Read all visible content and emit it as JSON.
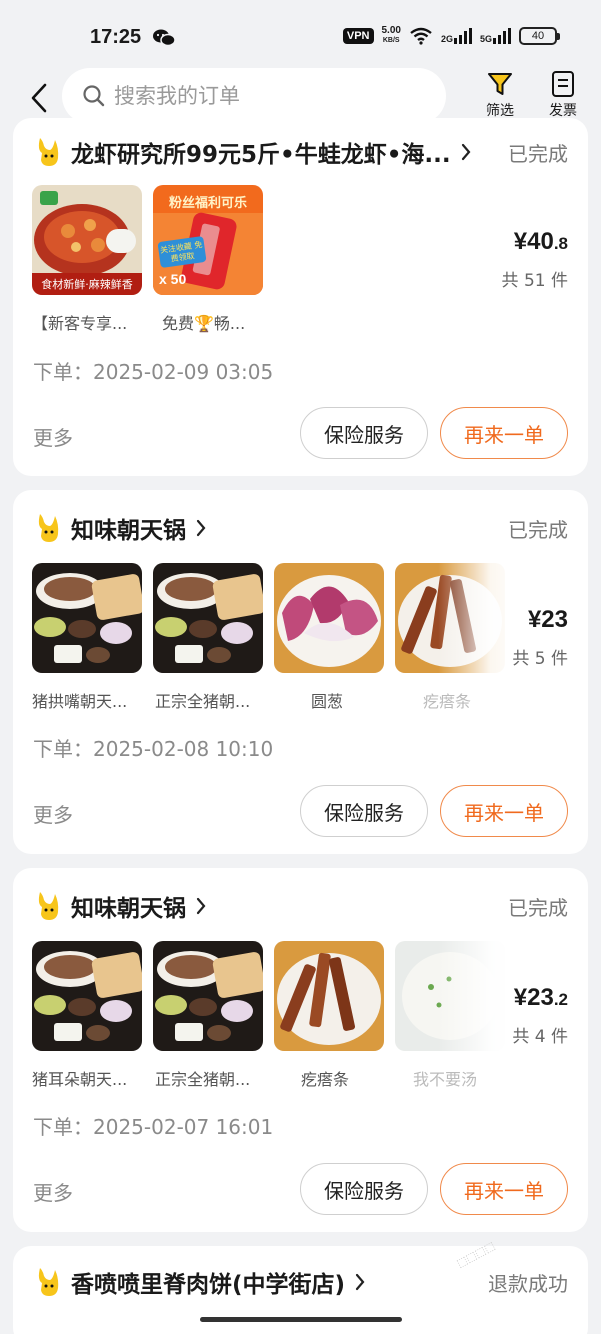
{
  "status_bar": {
    "time": "17:25",
    "vpn": "VPN",
    "speed": "5.00",
    "speed_unit": "KB/S",
    "net1": "2G",
    "net2": "5G",
    "battery": "40"
  },
  "header": {
    "search_placeholder": "搜索我的订单",
    "filter_label": "筛选",
    "invoice_label": "发票"
  },
  "orders": [
    {
      "shop": "龙虾研究所99元5斤•牛蛙龙虾•海...",
      "status": "已完成",
      "items": [
        {
          "caption": "【新客专享...",
          "tag": "食材新鲜·麻辣鲜香"
        },
        {
          "caption": "免费🏆畅...",
          "title": "粉丝福利可乐",
          "qty": "x 50",
          "badge": "关注收藏 免费领取"
        }
      ],
      "price_main": "¥40",
      "price_dec": ".8",
      "count": "共 51 件",
      "order_time": "下单：2025-02-09 03:05",
      "more": "更多",
      "insurance": "保险服务",
      "again": "再来一单"
    },
    {
      "shop": "知味朝天锅",
      "status": "已完成",
      "items": [
        {
          "caption": "猪拱嘴朝天..."
        },
        {
          "caption": "正宗全猪朝..."
        },
        {
          "caption": "圆葱"
        },
        {
          "caption": "疙瘩条"
        }
      ],
      "price_main": "¥23",
      "price_dec": "",
      "count": "共 5 件",
      "order_time": "下单：2025-02-08 10:10",
      "more": "更多",
      "insurance": "保险服务",
      "again": "再来一单"
    },
    {
      "shop": "知味朝天锅",
      "status": "已完成",
      "items": [
        {
          "caption": "猪耳朵朝天..."
        },
        {
          "caption": "正宗全猪朝..."
        },
        {
          "caption": "疙瘩条"
        },
        {
          "caption": "我不要汤"
        }
      ],
      "price_main": "¥23",
      "price_dec": ".2",
      "count": "共 4 件",
      "order_time": "下单：2025-02-07 16:01",
      "more": "更多",
      "insurance": "保险服务",
      "again": "再来一单"
    },
    {
      "shop": "香喷喷里脊肉饼(中学街店)",
      "status": "退款成功"
    }
  ],
  "colors": {
    "accent": "#f06a1e",
    "page_bg": "#f1f2f4",
    "logo_yellow": "#f7c51b"
  }
}
